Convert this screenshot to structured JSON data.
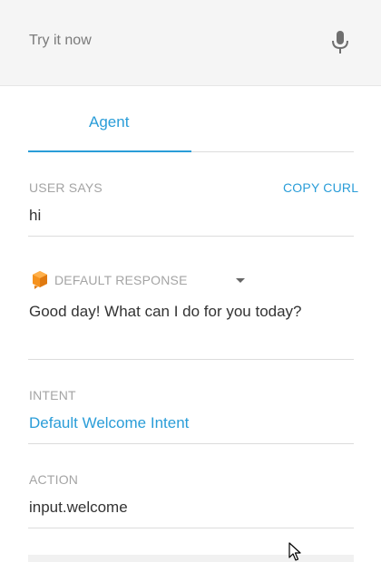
{
  "topbar": {
    "placeholder": "Try it now",
    "mic_icon": "microphone-icon"
  },
  "tabs": [
    {
      "label": "Agent",
      "active": true
    }
  ],
  "user_says": {
    "label": "USER SAYS",
    "value": "hi",
    "copy_curl": "COPY CURL"
  },
  "default_response": {
    "label": "DEFAULT RESPONSE",
    "value": "Good day! What can I do for you today?",
    "icon": "cube-icon",
    "dropdown_icon": "caret-down-icon"
  },
  "intent": {
    "label": "INTENT",
    "value": "Default Welcome Intent"
  },
  "action": {
    "label": "ACTION",
    "value": "input.welcome"
  },
  "colors": {
    "accent": "#2a9dd8",
    "icon_orange": "#f5921e",
    "label_gray": "#a4a4a4"
  }
}
